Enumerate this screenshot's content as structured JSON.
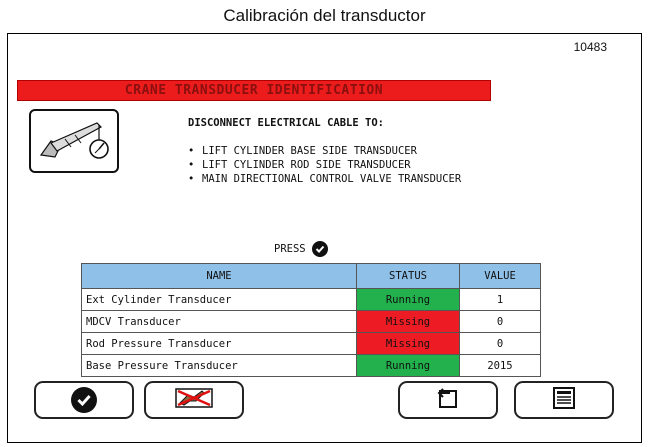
{
  "caption": "Calibración del transductor",
  "doc_number": "10483",
  "screen": {
    "title": "CRANE TRANSDUCER IDENTIFICATION",
    "instruction": "DISCONNECT ELECTRICAL CABLE TO:",
    "bullets": [
      "LIFT CYLINDER BASE SIDE TRANSDUCER",
      "LIFT CYLINDER ROD SIDE TRANSDUCER",
      "MAIN DIRECTIONAL CONTROL VALVE TRANSDUCER"
    ],
    "press_label": "PRESS"
  },
  "table": {
    "headers": [
      "NAME",
      "STATUS",
      "VALUE"
    ],
    "rows": [
      {
        "name": "Ext Cylinder Transducer",
        "status": "Running",
        "value": "1"
      },
      {
        "name": "MDCV Transducer",
        "status": "Missing",
        "value": "0"
      },
      {
        "name": "Rod Pressure Transducer",
        "status": "Missing",
        "value": "0"
      },
      {
        "name": "Base Pressure Transducer",
        "status": "Running",
        "value": "2015"
      }
    ]
  },
  "colors": {
    "header_red": "#ec1c1c",
    "running_green": "#22b14c",
    "missing_red": "#ed1c24",
    "table_header_blue": "#8fc0e8"
  },
  "buttons": {
    "confirm": "check-icon",
    "disable": "crossed-crane-icon",
    "back": "return-icon",
    "menu": "menu-list-icon"
  }
}
